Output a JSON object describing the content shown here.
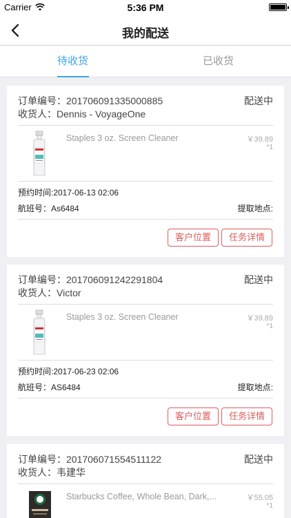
{
  "status_bar": {
    "carrier": "Carrier",
    "time": "5:36 PM"
  },
  "nav": {
    "title": "我的配送"
  },
  "tabs": [
    {
      "label": "待收货",
      "active": true
    },
    {
      "label": "已收货",
      "active": false
    }
  ],
  "colors": {
    "accent": "#3fa3e0",
    "action": "#e05a5a"
  },
  "orders": [
    {
      "order_label": "订单编号：",
      "order_no": "201706091335000885",
      "receiver_label": "收货人：",
      "receiver": "Dennis - VoyageOne",
      "status": "配送中",
      "product": {
        "name": "Staples 3 oz. Screen Cleaner",
        "price": "￥39.89",
        "qty": "*1",
        "icon": "spray-bottle-image"
      },
      "appointment": "预约时间:2017-06-13 02:06",
      "flight": "航班号：As6484",
      "pickup": "提取地点:",
      "buttons": {
        "location": "客户位置",
        "detail": "任务详情"
      }
    },
    {
      "order_label": "订单编号：",
      "order_no": "201706091242291804",
      "receiver_label": "收货人：",
      "receiver": "Victor",
      "status": "配送中",
      "product": {
        "name": "Staples 3 oz. Screen Cleaner",
        "price": "￥39.89",
        "qty": "*1",
        "icon": "spray-bottle-image"
      },
      "appointment": "预约时间:2017-06-23 02:06",
      "flight": "航班号：AS6484",
      "pickup": "提取地点:",
      "buttons": {
        "location": "客户位置",
        "detail": "任务详情"
      }
    },
    {
      "order_label": "订单编号：",
      "order_no": "201706071554511122",
      "receiver_label": "收货人：",
      "receiver": "韦建华",
      "status": "配送中",
      "product": {
        "name": "Starbucks Coffee, Whole Bean, Dark,...",
        "price": "￥55.05",
        "qty": "*1",
        "icon": "coffee-bag-image"
      }
    }
  ]
}
